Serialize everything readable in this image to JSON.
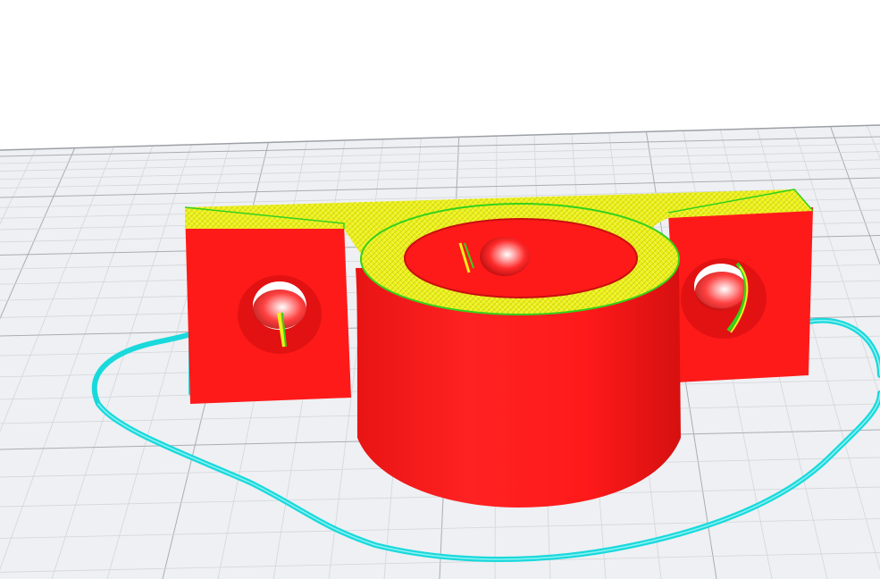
{
  "app": {
    "view": "layer-preview",
    "background_color": "#ffffff"
  },
  "build_plate": {
    "surface_color": "#eef0f3",
    "grid_major_color": "#a9adb3",
    "grid_minor_color": "#d3d6da",
    "grid_visible": true
  },
  "model": {
    "name": "",
    "wall_color": "#ff1a1a",
    "wall_shade_color": "#d81212",
    "infill_color": "#eef018",
    "infill_accent_color": "#34d11c",
    "features": [
      "mounting-base",
      "cylindrical-boss",
      "left-mounting-hole",
      "right-mounting-hole",
      "center-bore"
    ]
  },
  "skirt": {
    "color": "#19d9dc"
  }
}
